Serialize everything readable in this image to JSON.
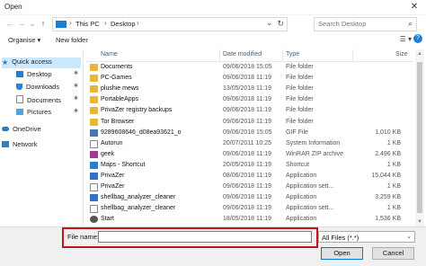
{
  "window": {
    "title": "Open",
    "close_glyph": "✕"
  },
  "address": {
    "back_glyph": "←",
    "forward_glyph": "→",
    "down_glyph": "⌄",
    "up_glyph": "↑",
    "crumbs": [
      "This PC",
      "Desktop"
    ],
    "sep_glyph": "›",
    "dropdown_glyph": "⌄",
    "refresh_glyph": "↻"
  },
  "search": {
    "placeholder": "Search Desktop",
    "icon_glyph": "⌕"
  },
  "toolbar": {
    "organise": "Organise ▾",
    "new_folder": "New folder",
    "view_glyph": "☰ ▾",
    "help_glyph": "?"
  },
  "nav": {
    "quick_access": "Quick access",
    "desktop": "Desktop",
    "downloads": "Downloads",
    "documents": "Documents",
    "pictures": "Pictures",
    "onedrive": "OneDrive",
    "network": "Network",
    "pin_glyph": "✱"
  },
  "columns": {
    "name": "Name",
    "date": "Date modified",
    "type": "Type",
    "size": "Size"
  },
  "files": [
    {
      "name": "Documents",
      "date": "09/06/2018 15:05",
      "type": "File folder",
      "size": "",
      "icon": "folder-icon"
    },
    {
      "name": "PC-Games",
      "date": "09/06/2018 11:19",
      "type": "File folder",
      "size": "",
      "icon": "folder-icon"
    },
    {
      "name": "plushie mews",
      "date": "13/05/2018 11:19",
      "type": "File folder",
      "size": "",
      "icon": "folder-icon"
    },
    {
      "name": "PortableApps",
      "date": "09/06/2018 11:19",
      "type": "File folder",
      "size": "",
      "icon": "folder-icon"
    },
    {
      "name": "PrivaZer registry backups",
      "date": "09/06/2018 11:19",
      "type": "File folder",
      "size": "",
      "icon": "folder-icon"
    },
    {
      "name": "Tor Browser",
      "date": "09/06/2018 11:19",
      "type": "File folder",
      "size": "",
      "icon": "folder-icon"
    },
    {
      "name": "9289608646_d08ea93621_o",
      "date": "09/06/2018 15:05",
      "type": "GIF File",
      "size": "1,010 KB",
      "icon": "gif-icon"
    },
    {
      "name": "Autorun",
      "date": "20/07/2011 10:25",
      "type": "System Information",
      "size": "1 KB",
      "icon": "autorun-icon"
    },
    {
      "name": "geek",
      "date": "09/06/2018 11:19",
      "type": "WinRAR ZIP archive",
      "size": "2,496 KB",
      "icon": "zip-icon"
    },
    {
      "name": "Maps - Shortcut",
      "date": "20/05/2018 11:19",
      "type": "Shortcut",
      "size": "1 KB",
      "icon": "shortcut-icon"
    },
    {
      "name": "PrivaZer",
      "date": "08/06/2018 11:19",
      "type": "Application",
      "size": "15,044 KB",
      "icon": "app-icon"
    },
    {
      "name": "PrivaZer",
      "date": "09/06/2018 11:19",
      "type": "Application sett...",
      "size": "1 KB",
      "icon": "settings-icon"
    },
    {
      "name": "shellbag_analyzer_cleaner",
      "date": "09/06/2018 11:19",
      "type": "Application",
      "size": "3,259 KB",
      "icon": "app-icon"
    },
    {
      "name": "shellbag_analyzer_cleaner",
      "date": "09/06/2018 11:19",
      "type": "Application sett...",
      "size": "1 KB",
      "icon": "settings-icon"
    },
    {
      "name": "Start",
      "date": "18/05/2018 11:19",
      "type": "Application",
      "size": "1,536 KB",
      "icon": "start-icon"
    }
  ],
  "footer": {
    "file_name_label": "File name:",
    "file_name_value": "",
    "file_type": "All Files (*.*)",
    "file_type_dd": "⌄",
    "open": "Open",
    "cancel": "Cancel"
  },
  "colors": {
    "highlight": "#c4121f",
    "selection": "#cce8ff",
    "folder": "#e8b63a",
    "accent": "#1e7fd2"
  }
}
